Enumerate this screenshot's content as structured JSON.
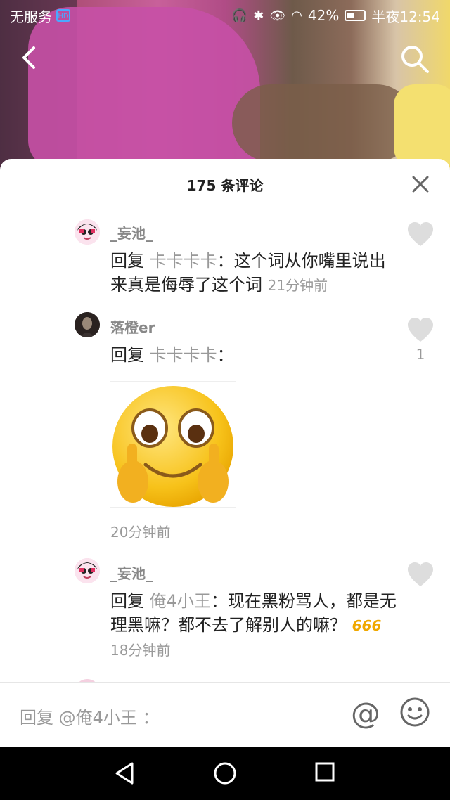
{
  "status_bar": {
    "carrier": "无服务",
    "battery": "42%",
    "time": "半夜12:54"
  },
  "sheet": {
    "title": "175 条评论"
  },
  "comments": [
    {
      "username": "_妄池_",
      "reply_prefix": "回复",
      "reply_to": "卡卡卡卡",
      "colon": "：",
      "body": "这个词从你嘴里说出来真是侮辱了这个词",
      "time": "21分钟前",
      "likes": "",
      "avatar_icon": "cartoon-avatar"
    },
    {
      "username": "落橙er",
      "reply_prefix": "回复",
      "reply_to": "卡卡卡卡",
      "colon": "：",
      "body": "",
      "time": "20分钟前",
      "likes": "1",
      "sticker": "smiley-middle-finger-sticker",
      "avatar_icon": "photo-avatar"
    },
    {
      "username": "_妄池_",
      "reply_prefix": "回复",
      "reply_to": "俺4小王",
      "colon": "：",
      "body": "现在黑粉骂人，都是无理黑嘛？都不去了解别人的嘛？",
      "emoji_text": "666",
      "time": "18分钟前",
      "likes": "",
      "avatar_icon": "cartoon-avatar"
    }
  ],
  "reply_bar": {
    "placeholder": "回复 @俺4小王 ："
  },
  "colors": {
    "accent_666": "#f0a800",
    "text_primary": "#222222",
    "text_secondary": "#999999"
  }
}
